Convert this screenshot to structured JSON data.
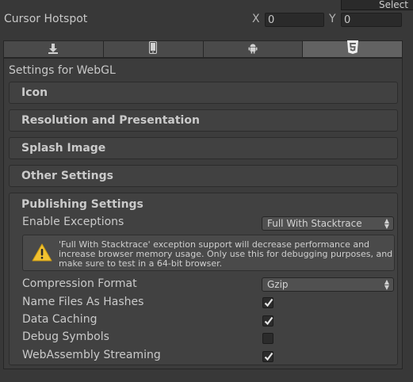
{
  "top": {
    "select_label": "Select",
    "hotspot_label": "Cursor Hotspot",
    "x_label": "X",
    "x_value": "0",
    "y_label": "Y",
    "y_value": "0"
  },
  "tabs": [
    {
      "icon": "download-icon",
      "active": false
    },
    {
      "icon": "mobile-icon",
      "active": false
    },
    {
      "icon": "android-icon",
      "active": false
    },
    {
      "icon": "html5-icon",
      "active": true
    }
  ],
  "panel": {
    "title": "Settings for WebGL",
    "sections": [
      "Icon",
      "Resolution and Presentation",
      "Splash Image",
      "Other Settings"
    ]
  },
  "publishing": {
    "header": "Publishing Settings",
    "enable_exceptions_label": "Enable Exceptions",
    "enable_exceptions_value": "Full With Stacktrace",
    "warning_text": "'Full With Stacktrace' exception support will decrease performance and increase browser memory usage. Only use this for debugging purposes, and make sure to test in a 64-bit browser.",
    "compression_label": "Compression Format",
    "compression_value": "Gzip",
    "name_files_label": "Name Files As Hashes",
    "name_files_checked": true,
    "data_caching_label": "Data Caching",
    "data_caching_checked": true,
    "debug_symbols_label": "Debug Symbols",
    "debug_symbols_checked": false,
    "wasm_streaming_label": "WebAssembly Streaming",
    "wasm_streaming_checked": true
  },
  "colors": {
    "background": "#383838",
    "warning_icon": "#f2c230",
    "text": "#c8c8c8"
  }
}
